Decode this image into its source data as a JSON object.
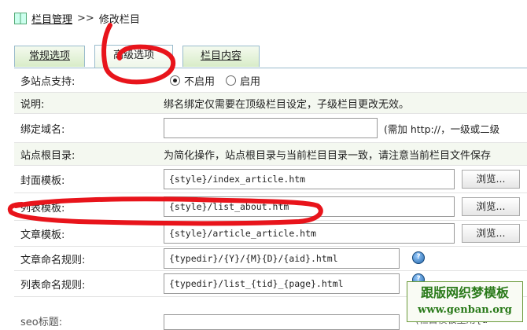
{
  "breadcrumb": {
    "root": "栏目管理",
    "separator": ">>",
    "current": "修改栏目"
  },
  "tabs": [
    {
      "label": "常规选项",
      "active": false
    },
    {
      "label": "高级选项",
      "active": true
    },
    {
      "label": "栏目内容",
      "active": false
    }
  ],
  "form": {
    "multisite": {
      "label": "多站点支持:",
      "options": [
        "不启用",
        "启用"
      ],
      "selected": "不启用"
    },
    "note": {
      "label": "说明:",
      "text": "绑名绑定仅需要在顶级栏目设定，子级栏目更改无效。"
    },
    "domain": {
      "label": "绑定域名:",
      "value": "",
      "hint": "(需加 http://，一级或二级"
    },
    "site_root": {
      "label": "站点根目录:",
      "text": "为简化操作，站点根目录与当前栏目目录一致，请注意当前栏目文件保存"
    },
    "cover_template": {
      "label": "封面模板:",
      "value": "{style}/index_article.htm",
      "button": "浏览..."
    },
    "list_template": {
      "label": "列表模板:",
      "value": "{style}/list_about.htm",
      "button": "浏览..."
    },
    "article_template": {
      "label": "文章模板:",
      "value": "{style}/article_article.htm",
      "button": "浏览..."
    },
    "article_naming": {
      "label": "文章命名规则:",
      "value": "{typedir}/{Y}/{M}{D}/{aid}.html"
    },
    "list_naming": {
      "label": "列表命名规则:",
      "value": "{typedir}/list_{tid}_{page}.html"
    },
    "seo_title": {
      "label": "seo标题:",
      "hint": "(栏目模板里用{d"
    }
  },
  "watermark": {
    "line1": "跟版网织梦模板",
    "line2": "www.genban.org"
  },
  "colors": {
    "annotation": "#e8141b",
    "watermark": "#2a7a1a",
    "tab_border": "#99bbcc"
  },
  "icons": {
    "breadcrumb": "book-icon",
    "help": "help-icon"
  }
}
